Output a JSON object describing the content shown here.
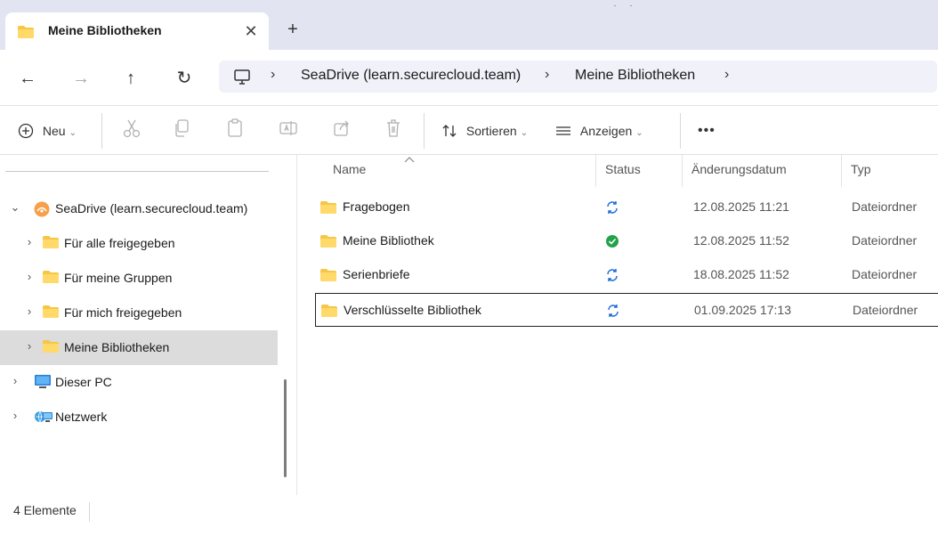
{
  "window": {
    "tab_title": "Meine Bibliotheken",
    "close_symbol": "✕",
    "new_tab_symbol": "+"
  },
  "nav": {
    "back": "←",
    "forward": "→",
    "up": "↑",
    "refresh": "↻"
  },
  "breadcrumb": {
    "separator": "›",
    "items": [
      "SeaDrive (learn.securecloud.team)",
      "Meine Bibliotheken"
    ]
  },
  "toolbar": {
    "new_label": "Neu",
    "sort_label": "Sortieren",
    "view_label": "Anzeigen",
    "more_label": "•••",
    "dropdown_symbol": "⌄"
  },
  "sidebar": {
    "items": [
      {
        "label": "SeaDrive (learn.securecloud.team)",
        "icon": "seadrive-icon",
        "expanded": true
      },
      {
        "label": "Für alle freigegeben",
        "icon": "folder-icon"
      },
      {
        "label": "Für meine Gruppen",
        "icon": "folder-icon"
      },
      {
        "label": "Für mich freigegeben",
        "icon": "folder-icon"
      },
      {
        "label": "Meine Bibliotheken",
        "icon": "folder-icon",
        "selected": true
      },
      {
        "label": "Dieser PC",
        "icon": "pc-icon"
      },
      {
        "label": "Netzwerk",
        "icon": "network-icon"
      }
    ]
  },
  "columns": {
    "name": "Name",
    "status": "Status",
    "date": "Änderungsdatum",
    "type": "Typ"
  },
  "files": [
    {
      "name": "Fragebogen",
      "status": "sync",
      "date": "12.08.2025 11:21",
      "type": "Dateiordner"
    },
    {
      "name": "Meine Bibliothek",
      "status": "synced",
      "date": "12.08.2025 11:52",
      "type": "Dateiordner"
    },
    {
      "name": "Serienbriefe",
      "status": "sync",
      "date": "18.08.2025 11:52",
      "type": "Dateiordner"
    },
    {
      "name": "Verschlüsselte Bibliothek",
      "status": "sync",
      "date": "01.09.2025 17:13",
      "type": "Dateiordner"
    }
  ],
  "status_bar": {
    "count": "4 Elemente"
  },
  "colors": {
    "folder": "#F6C744",
    "sync_blue": "#1E6FD8",
    "synced_green": "#22A24A",
    "tabstrip_bg": "#E3E4F2",
    "address_bg": "#F0F1F9",
    "selected_bg": "#DCDCDC"
  }
}
